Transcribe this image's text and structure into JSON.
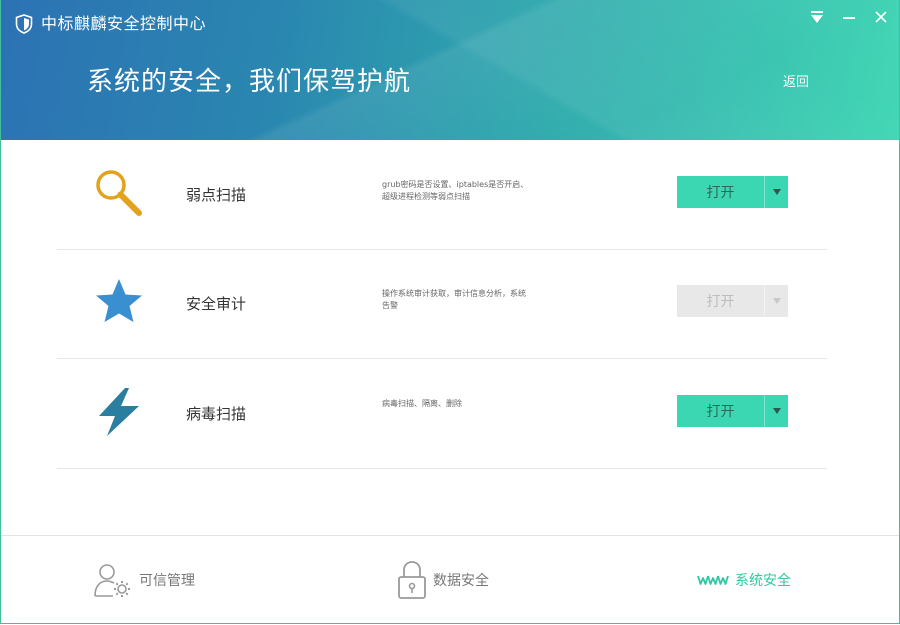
{
  "window": {
    "title": "中标麒麟安全控制中心",
    "controls": [
      "menu",
      "minimize",
      "close"
    ]
  },
  "banner": {
    "title": "系统的安全，我们保驾护航",
    "back_label": "返回"
  },
  "features": [
    {
      "name": "弱点扫描",
      "icon": "magnifier-icon",
      "description": "grub密码是否设置、iptables是否开启、超级进程检测等弱点扫描",
      "button_label": "打开",
      "enabled": true
    },
    {
      "name": "安全审计",
      "icon": "star-icon",
      "description": "操作系统审计获取，审计信息分析，系统告警",
      "button_label": "打开",
      "enabled": false
    },
    {
      "name": "病毒扫描",
      "icon": "lightning-icon",
      "description": "病毒扫描、隔离、删除",
      "button_label": "打开",
      "enabled": true
    }
  ],
  "nav": [
    {
      "label": "可信管理",
      "icon": "user-gear-icon",
      "active": false
    },
    {
      "label": "数据安全",
      "icon": "lock-icon",
      "active": false
    },
    {
      "label": "系统安全",
      "icon": "www-icon",
      "active": true
    }
  ],
  "colors": {
    "accent": "#3ad7b2",
    "header_start": "#2c72b4",
    "header_end": "#43d7b5",
    "active_nav": "#2fc8a2",
    "magnifier": "#e2a21b",
    "star": "#3a8fd0",
    "lightning": "#2a7fa0"
  }
}
